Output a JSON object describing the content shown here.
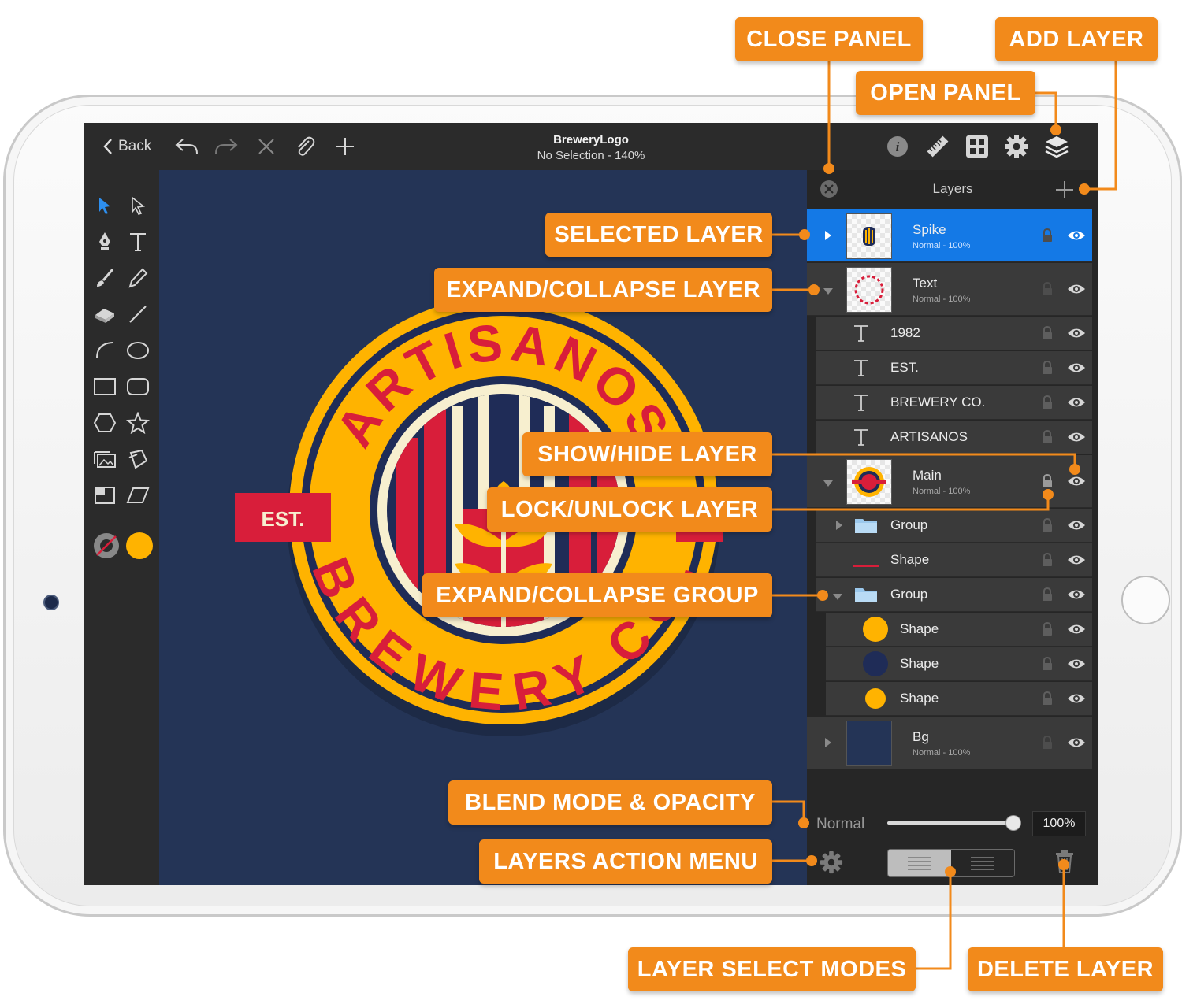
{
  "colors": {
    "accent": "#1479e6",
    "callout": "#f28a1b",
    "canvas": "#243456",
    "logo_yellow": "#ffb300",
    "logo_red": "#d81e3a",
    "logo_cream": "#f7efcf",
    "logo_navy": "#1f2c57"
  },
  "topbar": {
    "back_label": "Back",
    "doc_title": "BreweryLogo",
    "doc_status": "No Selection - 140%",
    "left_icons": [
      "undo-icon",
      "redo-icon",
      "delete-x-icon",
      "attach-paperclip-icon",
      "plus-icon"
    ],
    "right_icons": [
      "info-icon",
      "ruler-icon",
      "grid-icon",
      "gear-icon",
      "layers-icon"
    ]
  },
  "tools": [
    "select-arrow-icon",
    "direct-select-icon",
    "pen-icon",
    "text-tool-icon",
    "brush-icon",
    "pencil-icon",
    "eraser-icon",
    "line-icon",
    "arc-icon",
    "ellipse-icon",
    "rectangle-icon",
    "rounded-rect-icon",
    "hexagon-icon",
    "star-icon",
    "image-import-icon",
    "transform-icon",
    "crop-icon",
    "skew-icon"
  ],
  "fill_colors": {
    "stroke": "none",
    "fill": "#ffb300"
  },
  "logo": {
    "top_text": "ARTISANOS",
    "bottom_text": "BREWERY CO.",
    "banner_text": "EST."
  },
  "layers": {
    "title": "Layers",
    "rows": [
      {
        "name": "Spike",
        "sub": "Normal - 100%",
        "kind": "layer",
        "selected": true
      },
      {
        "name": "Text",
        "sub": "Normal - 100%",
        "kind": "layer"
      },
      {
        "name": "1982",
        "kind": "text"
      },
      {
        "name": "EST.",
        "kind": "text"
      },
      {
        "name": "BREWERY CO.",
        "kind": "text"
      },
      {
        "name": "ARTISANOS",
        "kind": "text"
      },
      {
        "name": "Main",
        "sub": "Normal - 100%",
        "kind": "layer"
      },
      {
        "name": "Group",
        "kind": "group"
      },
      {
        "name": "Shape",
        "kind": "shape-line"
      },
      {
        "name": "Group",
        "kind": "group"
      },
      {
        "name": "Shape",
        "kind": "shape-dot-yellow"
      },
      {
        "name": "Shape",
        "kind": "shape-dot-navy"
      },
      {
        "name": "Shape",
        "kind": "shape-dot-yellow-small"
      },
      {
        "name": "Bg",
        "sub": "Normal - 100%",
        "kind": "layer"
      }
    ],
    "blend_mode": "Normal",
    "opacity_label": "100%",
    "opacity": 1.0
  },
  "callouts": {
    "close_panel": "CLOSE PANEL",
    "add_layer": "ADD LAYER",
    "open_panel": "OPEN PANEL",
    "selected_layer": "SELECTED LAYER",
    "expand_collapse_layer": "EXPAND/COLLAPSE LAYER",
    "show_hide_layer": "SHOW/HIDE LAYER",
    "lock_unlock_layer": "LOCK/UNLOCK LAYER",
    "expand_collapse_group": "EXPAND/COLLAPSE GROUP",
    "blend_mode_opacity": "BLEND MODE & OPACITY",
    "layers_action_menu": "LAYERS ACTION MENU",
    "layer_select_modes": "LAYER SELECT MODES",
    "delete_layer": "DELETE LAYER"
  }
}
